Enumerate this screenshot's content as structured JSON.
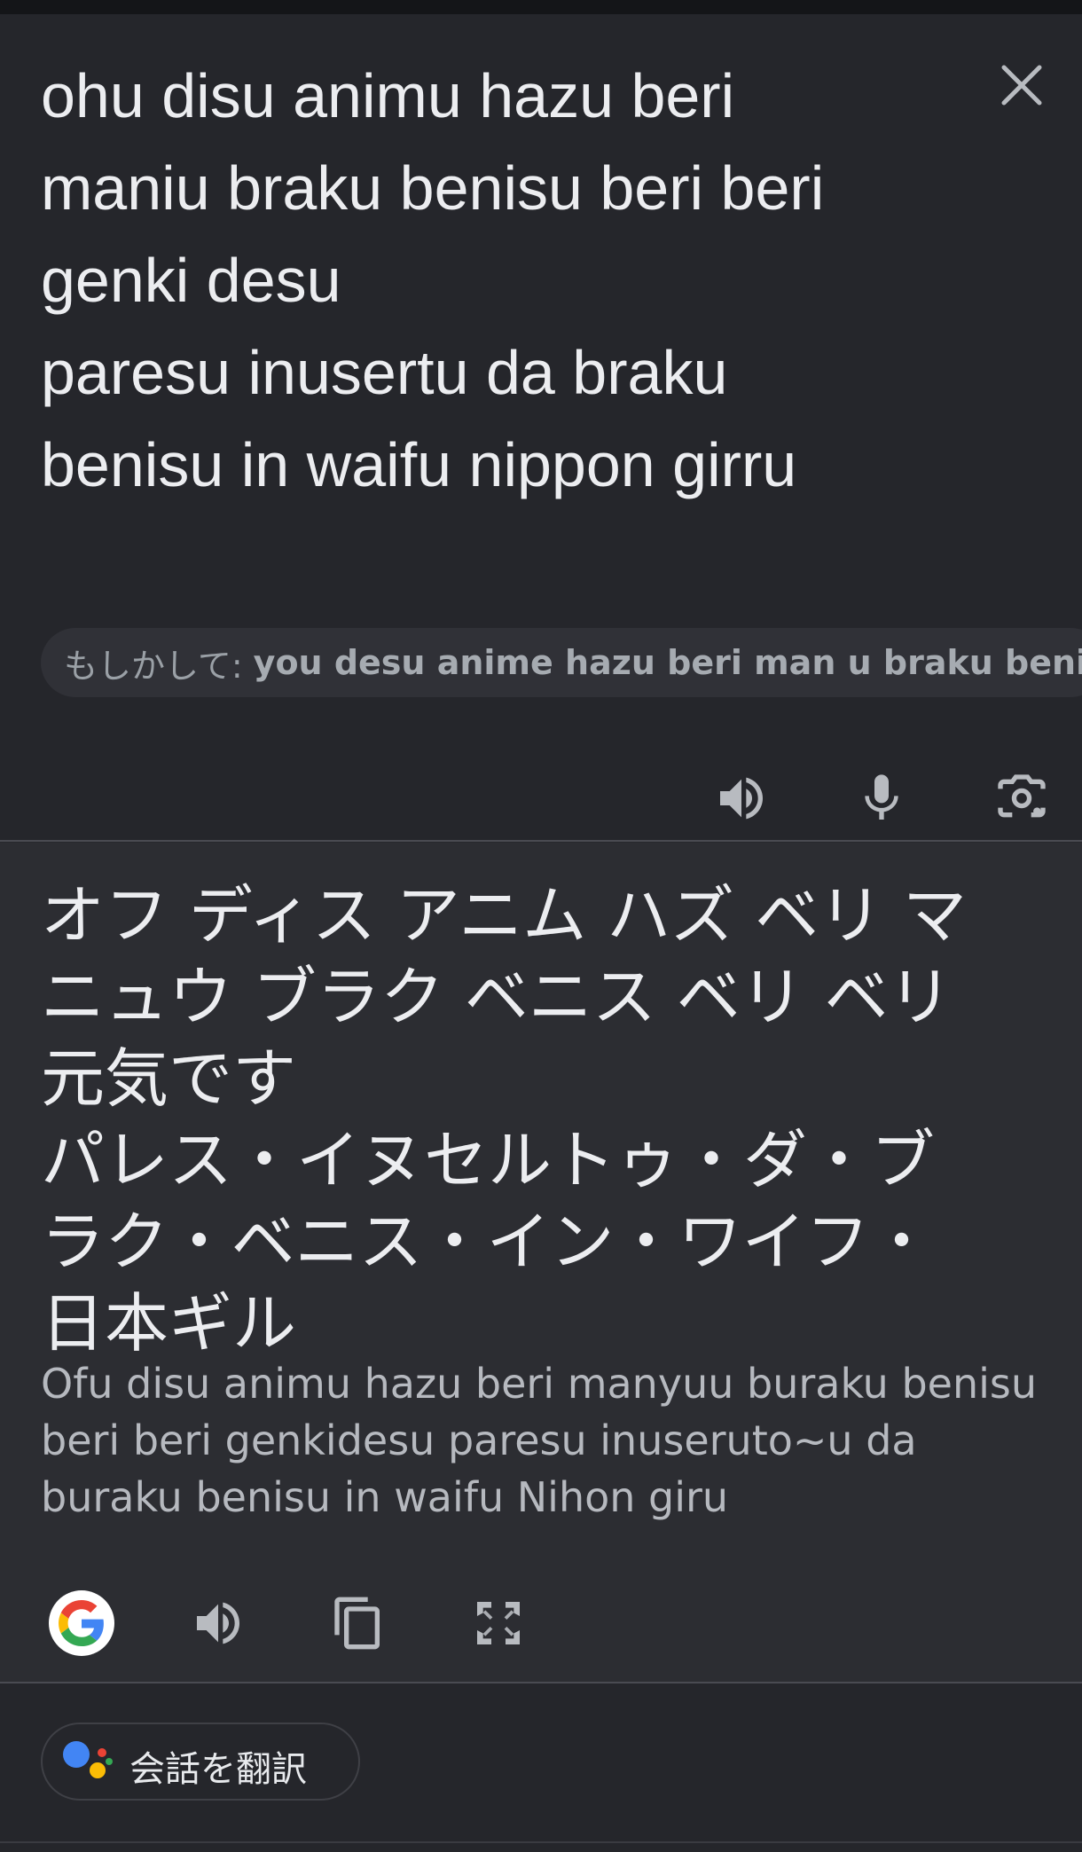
{
  "source": {
    "text": "ohu disu animu hazu beri\nmaniu braku benisu beri beri\ngenki desu\nparesu inusertu da braku\nbenisu in waifu nippon girru",
    "close_icon": "close-icon",
    "suggestion_prefix": "もしかして:",
    "suggestion_term": "you desu anime hazu beri man u braku benisu beri beri genki desu",
    "tools": [
      "speaker-icon",
      "microphone-icon",
      "camera-icon"
    ]
  },
  "target": {
    "text": "オフ ディス アニム ハズ ベリ マ\nニュウ ブラク ベニス ベリ ベリ\n元気です\nパレス・イヌセルトゥ・ダ・ブ\nラク・ベニス・イン・ワイフ・\n日本ギル",
    "romanization": "Ofu disu animu hazu beri manyuu buraku benisu beri beri genkidesu paresu inuseruto~u da buraku benisu in waifu Nihon giru",
    "tools": [
      "google-logo",
      "speaker-icon",
      "copy-icon",
      "fullscreen-icon"
    ]
  },
  "conversation": {
    "label": "会話を翻訳",
    "icon": "assistant-icon",
    "colors": [
      "#4285f4",
      "#ea4335",
      "#fbbc05",
      "#34a853"
    ]
  },
  "colors": {
    "background": "#25262b",
    "text": "#ecedf0",
    "icon": "#b8bbc0"
  }
}
